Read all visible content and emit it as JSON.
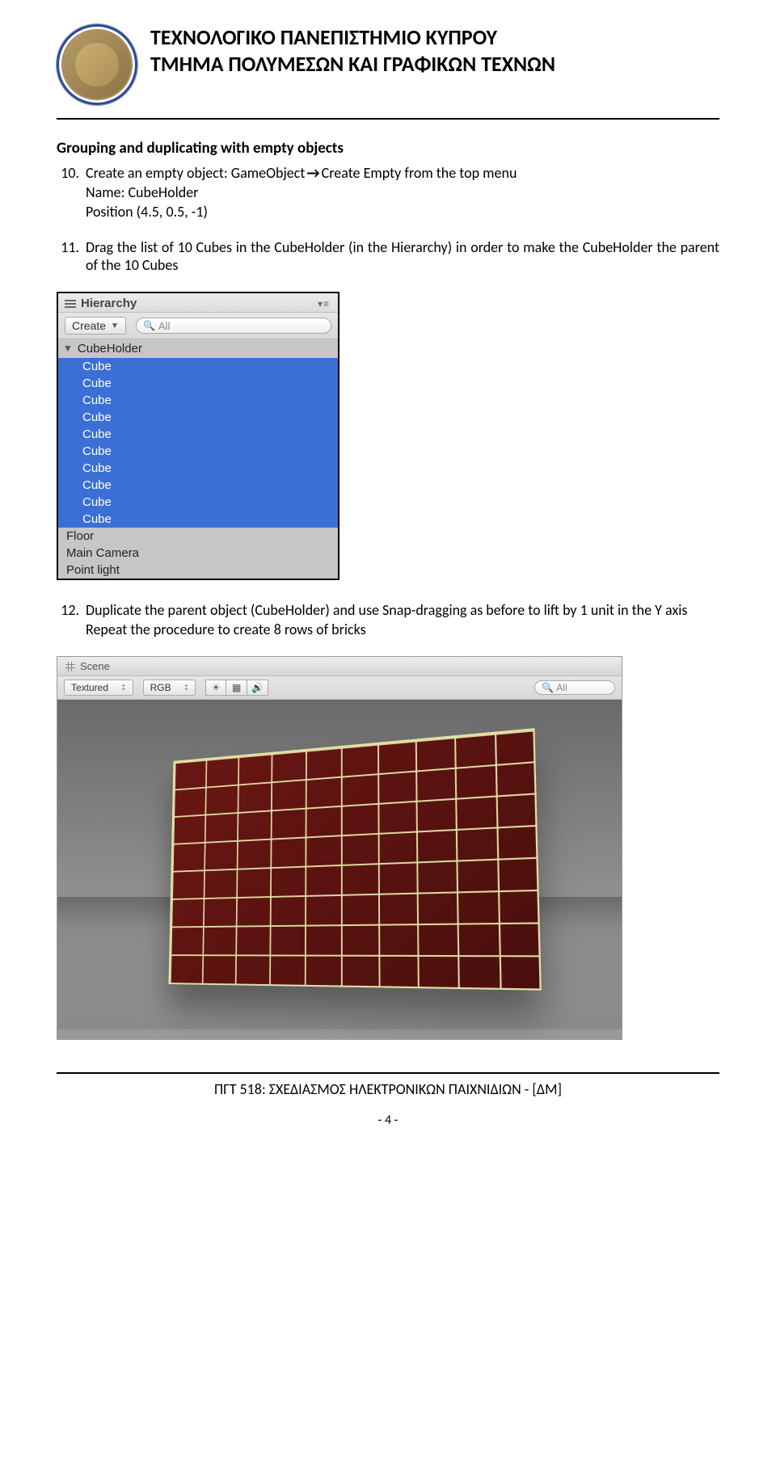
{
  "header": {
    "org_line1": "ΤΕΧΝΟΛΟΓΙΚΟ ΠΑΝΕΠΙΣΤΗΜΙΟ ΚΥΠΡΟΥ",
    "org_line2": "ΤΜΗΜΑ ΠΟΛΥΜΕΣΩΝ ΚΑΙ ΓΡΑΦΙΚΩΝ ΤΕΧΝΩΝ"
  },
  "section_title": "Grouping and duplicating with empty objects",
  "step10": {
    "num": "10.",
    "line1_a": "Create an empty object: GameObject",
    "line1_b": "Create Empty from the top menu",
    "name_line": "Name: CubeHolder",
    "pos_line": "Position (4.5, 0.5, -1)"
  },
  "step11": {
    "num": "11.",
    "text": "Drag the list of 10 Cubes in the CubeHolder (in the Hierarchy) in order to make the CubeHolder the parent of the 10 Cubes"
  },
  "hierarchy": {
    "title": "Hierarchy",
    "create": "Create",
    "search_ph": "All",
    "parent": "CubeHolder",
    "child": "Cube",
    "others": [
      "Floor",
      "Main Camera",
      "Point light"
    ]
  },
  "step12": {
    "num": "12.",
    "text": "Duplicate the parent object (CubeHolder) and use Snap-dragging as before to lift by 1 unit in the Y axis",
    "repeat": "Repeat the procedure to create 8 rows of bricks"
  },
  "scene": {
    "title": "Scene",
    "shade": "Textured",
    "mode": "RGB",
    "search_ph": "All"
  },
  "footer": {
    "course": "ΠΓΤ 518: ΣΧΕΔΙΑΣΜΟΣ ΗΛΕΚΤΡΟΝΙΚΩΝ ΠΑΙΧΝΙΔΙΩΝ - [ΔΜ]",
    "page": "- 4 -"
  }
}
